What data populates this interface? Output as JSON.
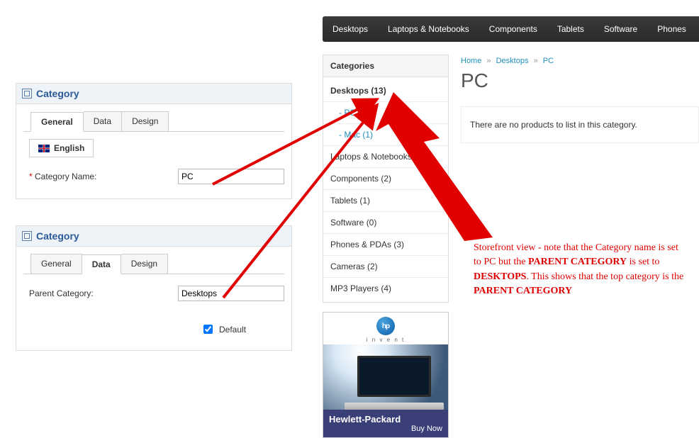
{
  "admin": {
    "panel_title": "Category",
    "tabs": {
      "general": "General",
      "data": "Data",
      "design": "Design"
    },
    "lang_tab": "English",
    "cat_name_label": "Category Name:",
    "cat_name_value": "PC",
    "parent_label": "Parent Category:",
    "parent_value": "Desktops",
    "default_label": "Default"
  },
  "topnav": [
    "Desktops",
    "Laptops & Notebooks",
    "Components",
    "Tablets",
    "Software",
    "Phones"
  ],
  "sidebar": {
    "title": "Categories",
    "items": [
      {
        "label": "Desktops (13)",
        "current": true,
        "children": [
          {
            "label": "PC (0)",
            "active": true
          },
          {
            "label": "Mac (1)"
          }
        ]
      },
      {
        "label": "Laptops & Notebooks (5)"
      },
      {
        "label": "Components (2)"
      },
      {
        "label": "Tablets (1)"
      },
      {
        "label": "Software (0)"
      },
      {
        "label": "Phones & PDAs (3)"
      },
      {
        "label": "Cameras (2)"
      },
      {
        "label": "MP3 Players (4)"
      }
    ]
  },
  "breadcrumb": {
    "home": "Home",
    "mid": "Desktops",
    "last": "PC",
    "sep": "»"
  },
  "page_title": "PC",
  "empty_msg": "There are no products to list in this category.",
  "annotation": {
    "t1": "Storefront view - note that the Category name is set to PC but the ",
    "b1": "PARENT CATEGORY",
    "t2": " is set to ",
    "b2": "DESKTOPS",
    "t3": ".  This shows that the top category is the ",
    "b3": "PARENT CATEGORY"
  },
  "promo": {
    "logo_text": "hp",
    "invent": "i n v e n t",
    "line1": "Hewlett-Packard",
    "line2": "Buy Now"
  }
}
